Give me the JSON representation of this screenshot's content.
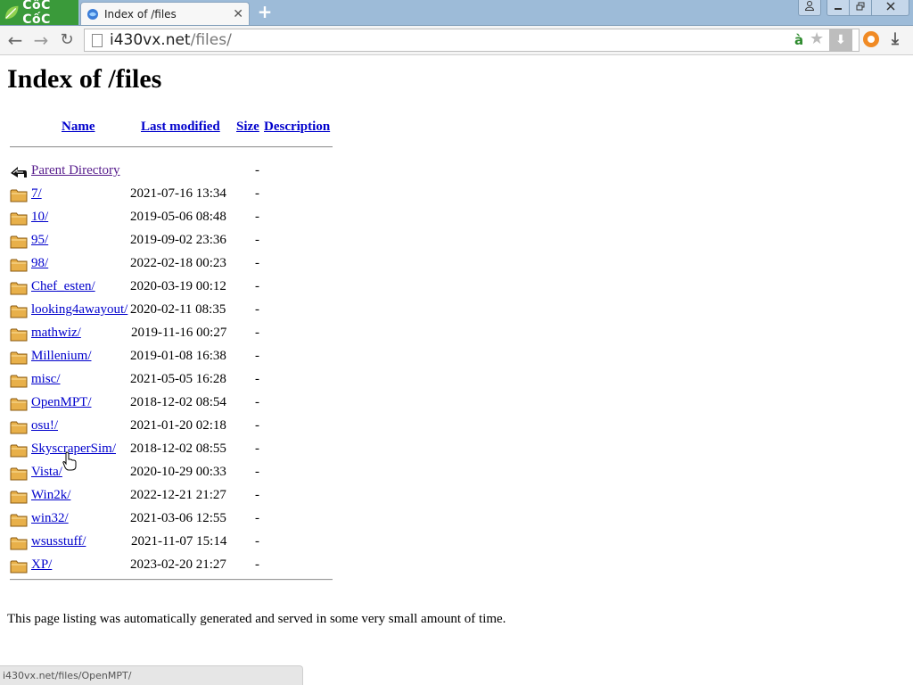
{
  "browser": {
    "brand": "CốC CốC",
    "tab_title": "Index of /files",
    "tab_close": "✕",
    "new_tab": "+",
    "url_host": "i430vx.net",
    "url_path": "/files/",
    "status_url": "i430vx.net/files/OpenMPT/"
  },
  "page": {
    "title": "Index of /files",
    "headers": {
      "name": "Name",
      "last_modified": "Last modified",
      "size": "Size",
      "description": "Description"
    },
    "parent": {
      "name": "Parent Directory",
      "size": "-"
    },
    "entries": [
      {
        "name": "7/",
        "modified": "2021-07-16 13:34",
        "size": "-"
      },
      {
        "name": "10/",
        "modified": "2019-05-06 08:48",
        "size": "-"
      },
      {
        "name": "95/",
        "modified": "2019-09-02 23:36",
        "size": "-"
      },
      {
        "name": "98/",
        "modified": "2022-02-18 00:23",
        "size": "-"
      },
      {
        "name": "Chef_esten/",
        "modified": "2020-03-19 00:12",
        "size": "-"
      },
      {
        "name": "looking4awayout/",
        "modified": "2020-02-11 08:35",
        "size": "-"
      },
      {
        "name": "mathwiz/",
        "modified": "2019-11-16 00:27",
        "size": "-"
      },
      {
        "name": "Millenium/",
        "modified": "2019-01-08 16:38",
        "size": "-"
      },
      {
        "name": "misc/",
        "modified": "2021-05-05 16:28",
        "size": "-"
      },
      {
        "name": "OpenMPT/",
        "modified": "2018-12-02 08:54",
        "size": "-"
      },
      {
        "name": "osu!/",
        "modified": "2021-01-20 02:18",
        "size": "-"
      },
      {
        "name": "SkyscraperSim/",
        "modified": "2018-12-02 08:55",
        "size": "-"
      },
      {
        "name": "Vista/",
        "modified": "2020-10-29 00:33",
        "size": "-"
      },
      {
        "name": "Win2k/",
        "modified": "2022-12-21 21:27",
        "size": "-"
      },
      {
        "name": "win32/",
        "modified": "2021-03-06 12:55",
        "size": "-"
      },
      {
        "name": "wsusstuff/",
        "modified": "2021-11-07 15:14",
        "size": "-"
      },
      {
        "name": "XP/",
        "modified": "2023-02-20 21:27",
        "size": "-"
      }
    ],
    "footer": "This page listing was automatically generated and served in some very small amount of time."
  }
}
